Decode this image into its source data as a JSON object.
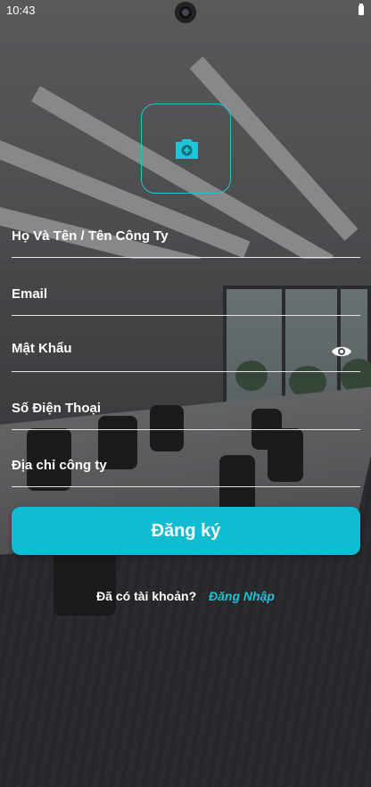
{
  "status_bar": {
    "time": "10:43"
  },
  "avatar_picker": {
    "icon": "add-photo-camera-icon",
    "accent": "#22c3d8"
  },
  "form": {
    "full_name_label": "Họ Và Tên / Tên Công Ty",
    "email_label": "Email",
    "password_label": "Mật Khẩu",
    "password_toggle_icon": "eye-icon",
    "phone_label": "Số Điện Thoại",
    "address_label": "Địa chỉ công ty"
  },
  "signup_button": {
    "label": "Đăng ký",
    "color": "#10bcd1"
  },
  "login_prompt": {
    "question": "Đã có tài khoản?",
    "link": "Đăng Nhập",
    "link_color": "#1fc3d8"
  }
}
